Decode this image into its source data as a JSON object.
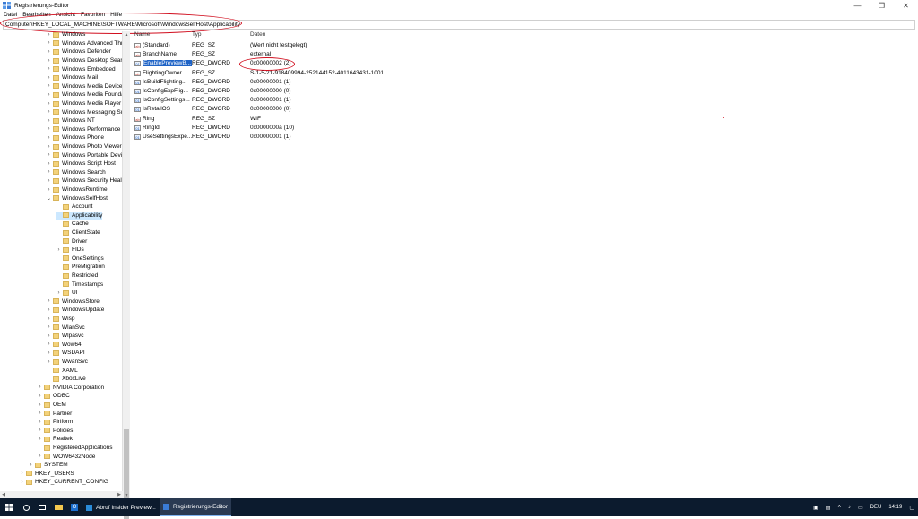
{
  "window": {
    "title": "Registrierungs-Editor",
    "controls": [
      "—",
      "❐",
      "✕"
    ]
  },
  "menu": [
    "Datei",
    "Bearbeiten",
    "Ansicht",
    "Favoriten",
    "Hilfe"
  ],
  "address": "Computer\\HKEY_LOCAL_MACHINE\\SOFTWARE\\Microsoft\\WindowsSelfHost\\Applicability",
  "tree": [
    {
      "label": "Windows",
      "level": 2,
      "chev": "›"
    },
    {
      "label": "Windows Advanced Thre",
      "level": 2,
      "chev": "›"
    },
    {
      "label": "Windows Defender",
      "level": 2,
      "chev": "›"
    },
    {
      "label": "Windows Desktop Search",
      "level": 2,
      "chev": "›"
    },
    {
      "label": "Windows Embedded",
      "level": 2,
      "chev": "›"
    },
    {
      "label": "Windows Mail",
      "level": 2,
      "chev": "›"
    },
    {
      "label": "Windows Media Device M",
      "level": 2,
      "chev": "›"
    },
    {
      "label": "Windows Media Foundat",
      "level": 2,
      "chev": "›"
    },
    {
      "label": "Windows Media Player N",
      "level": 2,
      "chev": "›"
    },
    {
      "label": "Windows Messaging Sub",
      "level": 2,
      "chev": "›"
    },
    {
      "label": "Windows NT",
      "level": 2,
      "chev": "›"
    },
    {
      "label": "Windows Performance T",
      "level": 2,
      "chev": "›"
    },
    {
      "label": "Windows Phone",
      "level": 2,
      "chev": "›"
    },
    {
      "label": "Windows Photo Viewer",
      "level": 2,
      "chev": "›"
    },
    {
      "label": "Windows Portable Device",
      "level": 2,
      "chev": "›"
    },
    {
      "label": "Windows Script Host",
      "level": 2,
      "chev": "›"
    },
    {
      "label": "Windows Search",
      "level": 2,
      "chev": "›"
    },
    {
      "label": "Windows Security Health",
      "level": 2,
      "chev": "›"
    },
    {
      "label": "WindowsRuntime",
      "level": 2,
      "chev": "›"
    },
    {
      "label": "WindowsSelfHost",
      "level": 2,
      "chev": "⌄"
    },
    {
      "label": "Account",
      "level": 3,
      "chev": ""
    },
    {
      "label": "Applicability",
      "level": 3,
      "chev": "",
      "selected": true
    },
    {
      "label": "Cache",
      "level": 3,
      "chev": ""
    },
    {
      "label": "ClientState",
      "level": 3,
      "chev": ""
    },
    {
      "label": "Driver",
      "level": 3,
      "chev": ""
    },
    {
      "label": "FIDs",
      "level": 3,
      "chev": "›"
    },
    {
      "label": "OneSettings",
      "level": 3,
      "chev": ""
    },
    {
      "label": "PreMigration",
      "level": 3,
      "chev": ""
    },
    {
      "label": "Restricted",
      "level": 3,
      "chev": ""
    },
    {
      "label": "Timestamps",
      "level": 3,
      "chev": ""
    },
    {
      "label": "UI",
      "level": 3,
      "chev": "›"
    },
    {
      "label": "WindowsStore",
      "level": 2,
      "chev": "›"
    },
    {
      "label": "WindowsUpdate",
      "level": 2,
      "chev": "›"
    },
    {
      "label": "Wisp",
      "level": 2,
      "chev": "›"
    },
    {
      "label": "WlanSvc",
      "level": 2,
      "chev": "›"
    },
    {
      "label": "Wlpasvc",
      "level": 2,
      "chev": "›"
    },
    {
      "label": "Wow64",
      "level": 2,
      "chev": "›"
    },
    {
      "label": "WSDAPI",
      "level": 2,
      "chev": "›"
    },
    {
      "label": "WwanSvc",
      "level": 2,
      "chev": "›"
    },
    {
      "label": "XAML",
      "level": 2,
      "chev": ""
    },
    {
      "label": "XboxLive",
      "level": 2,
      "chev": ""
    },
    {
      "label": "NVIDIA Corporation",
      "level": 1,
      "chev": "›"
    },
    {
      "label": "ODBC",
      "level": 1,
      "chev": "›"
    },
    {
      "label": "OEM",
      "level": 1,
      "chev": "›"
    },
    {
      "label": "Partner",
      "level": 1,
      "chev": "›"
    },
    {
      "label": "Piriform",
      "level": 1,
      "chev": "›"
    },
    {
      "label": "Policies",
      "level": 1,
      "chev": "›"
    },
    {
      "label": "Realtek",
      "level": 1,
      "chev": "›"
    },
    {
      "label": "RegisteredApplications",
      "level": 1,
      "chev": ""
    },
    {
      "label": "WOW6432Node",
      "level": 1,
      "chev": "›"
    },
    {
      "label": "SYSTEM",
      "level": 0,
      "chev": "›"
    },
    {
      "label": "HKEY_USERS",
      "level": -1,
      "chev": "›"
    },
    {
      "label": "HKEY_CURRENT_CONFIG",
      "level": -1,
      "chev": "›"
    }
  ],
  "columns": {
    "name": "Name",
    "type": "Typ",
    "data": "Daten"
  },
  "values": [
    {
      "name": "(Standard)",
      "type": "REG_SZ",
      "data": "(Wert nicht festgelegt)",
      "icon": "ab"
    },
    {
      "name": "BranchName",
      "type": "REG_SZ",
      "data": "external",
      "icon": "ab"
    },
    {
      "name": "EnablePreviewB...",
      "type": "REG_DWORD",
      "data": "0x00000002 (2)",
      "icon": "bin",
      "selected": true
    },
    {
      "name": "FlightingOwner...",
      "type": "REG_SZ",
      "data": "S-1-5-21-918409994-252144152-4011643431-1001",
      "icon": "ab"
    },
    {
      "name": "IsBuildFlighting...",
      "type": "REG_DWORD",
      "data": "0x00000001 (1)",
      "icon": "bin"
    },
    {
      "name": "IsConfigExpFlig...",
      "type": "REG_DWORD",
      "data": "0x00000000 (0)",
      "icon": "bin"
    },
    {
      "name": "IsConfigSettings...",
      "type": "REG_DWORD",
      "data": "0x00000001 (1)",
      "icon": "bin"
    },
    {
      "name": "IsRetailOS",
      "type": "REG_DWORD",
      "data": "0x00000000 (0)",
      "icon": "bin"
    },
    {
      "name": "Ring",
      "type": "REG_SZ",
      "data": "WIF",
      "icon": "ab"
    },
    {
      "name": "RingId",
      "type": "REG_DWORD",
      "data": "0x0000000a (10)",
      "icon": "bin"
    },
    {
      "name": "UseSettingsExpe...",
      "type": "REG_DWORD",
      "data": "0x00000001 (1)",
      "icon": "bin"
    }
  ],
  "taskbar": {
    "apps": [
      {
        "label": "Abruf Insider Preview..."
      },
      {
        "label": "Registrierungs-Editor"
      }
    ],
    "tray": {
      "lang": "DEU",
      "time": "14:19"
    }
  },
  "colors": {
    "selection": "#1e63c6",
    "tree_selection": "#cce8ff",
    "annotation": "#d10f1f",
    "taskbar": "#0c1b2e"
  }
}
